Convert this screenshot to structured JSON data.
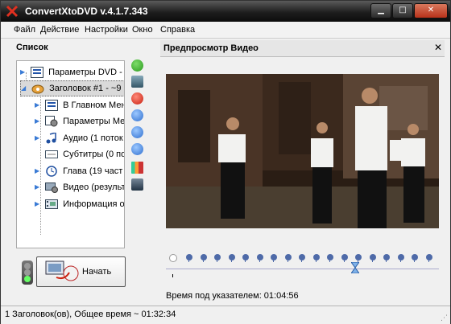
{
  "window": {
    "title": "ConvertXtoDVD v.4.1.7.343",
    "minimize_glyph": "▁",
    "maximize_glyph": "□",
    "close_glyph": "✕"
  },
  "menu": [
    "Файл",
    "Действие",
    "Настройки",
    "Окно",
    "Справка"
  ],
  "left_panel": {
    "title": "Список",
    "tree": [
      {
        "label": "Параметры DVD - И",
        "icon": "dvd-settings-icon"
      },
      {
        "label": "Заголовок #1 - ~9",
        "icon": "title-disc-icon"
      },
      {
        "label": "В Главном Меню",
        "icon": "main-menu-icon"
      },
      {
        "label": "Параметры Мен",
        "icon": "menu-settings-icon"
      },
      {
        "label": "Аудио (1 поток",
        "icon": "audio-note-icon"
      },
      {
        "label": "Субтитры (0 по",
        "icon": "subtitles-icon"
      },
      {
        "label": "Глава (19 част",
        "icon": "chapter-clock-icon"
      },
      {
        "label": "Видео (результ",
        "icon": "video-settings-icon"
      },
      {
        "label": "Информация об",
        "icon": "info-film-icon"
      }
    ],
    "side_buttons": [
      "add-icon",
      "replace-icon",
      "remove-icon",
      "info-icon",
      "move-up-icon",
      "move-down-icon",
      "level-icon",
      "monitor-icon"
    ],
    "start_button": "Начать"
  },
  "preview": {
    "title": "Предпросмотр Видео",
    "time_label": "Время под указателем: 01:04:56",
    "chapter_marker_count": 19
  },
  "status": {
    "text": "1 Заголовок(ов), Общее время ~ 01:32:34"
  },
  "colors": {
    "titlebar": "#1e1e1e",
    "accent_blue": "#4e6aa8",
    "close_red": "#c0442a"
  }
}
